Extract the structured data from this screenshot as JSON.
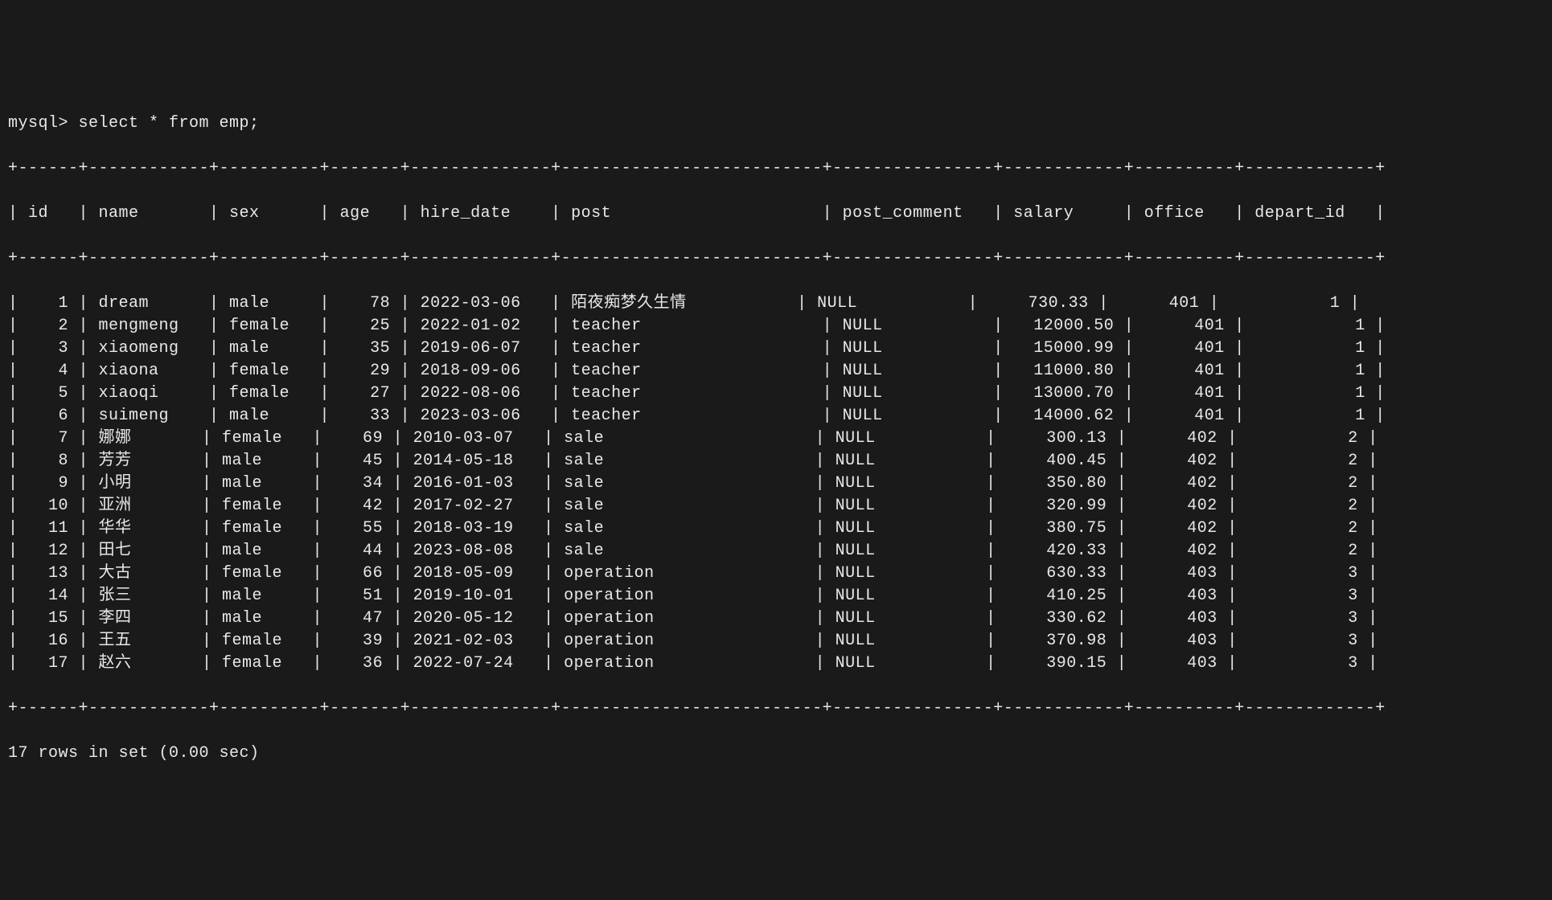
{
  "prompt": "mysql> select * from emp;",
  "chart_data": {
    "type": "table",
    "columns": [
      "id",
      "name",
      "sex",
      "age",
      "hire_date",
      "post",
      "post_comment",
      "salary",
      "office",
      "depart_id"
    ],
    "rows": [
      {
        "id": "1",
        "name": "dream",
        "sex": "male",
        "age": "78",
        "hire_date": "2022-03-06",
        "post": "陌夜痴梦久生情",
        "post_comment": "NULL",
        "salary": "730.33",
        "office": "401",
        "depart_id": "1"
      },
      {
        "id": "2",
        "name": "mengmeng",
        "sex": "female",
        "age": "25",
        "hire_date": "2022-01-02",
        "post": "teacher",
        "post_comment": "NULL",
        "salary": "12000.50",
        "office": "401",
        "depart_id": "1"
      },
      {
        "id": "3",
        "name": "xiaomeng",
        "sex": "male",
        "age": "35",
        "hire_date": "2019-06-07",
        "post": "teacher",
        "post_comment": "NULL",
        "salary": "15000.99",
        "office": "401",
        "depart_id": "1"
      },
      {
        "id": "4",
        "name": "xiaona",
        "sex": "female",
        "age": "29",
        "hire_date": "2018-09-06",
        "post": "teacher",
        "post_comment": "NULL",
        "salary": "11000.80",
        "office": "401",
        "depart_id": "1"
      },
      {
        "id": "5",
        "name": "xiaoqi",
        "sex": "female",
        "age": "27",
        "hire_date": "2022-08-06",
        "post": "teacher",
        "post_comment": "NULL",
        "salary": "13000.70",
        "office": "401",
        "depart_id": "1"
      },
      {
        "id": "6",
        "name": "suimeng",
        "sex": "male",
        "age": "33",
        "hire_date": "2023-03-06",
        "post": "teacher",
        "post_comment": "NULL",
        "salary": "14000.62",
        "office": "401",
        "depart_id": "1"
      },
      {
        "id": "7",
        "name": "娜娜",
        "sex": "female",
        "age": "69",
        "hire_date": "2010-03-07",
        "post": "sale",
        "post_comment": "NULL",
        "salary": "300.13",
        "office": "402",
        "depart_id": "2"
      },
      {
        "id": "8",
        "name": "芳芳",
        "sex": "male",
        "age": "45",
        "hire_date": "2014-05-18",
        "post": "sale",
        "post_comment": "NULL",
        "salary": "400.45",
        "office": "402",
        "depart_id": "2"
      },
      {
        "id": "9",
        "name": "小明",
        "sex": "male",
        "age": "34",
        "hire_date": "2016-01-03",
        "post": "sale",
        "post_comment": "NULL",
        "salary": "350.80",
        "office": "402",
        "depart_id": "2"
      },
      {
        "id": "10",
        "name": "亚洲",
        "sex": "female",
        "age": "42",
        "hire_date": "2017-02-27",
        "post": "sale",
        "post_comment": "NULL",
        "salary": "320.99",
        "office": "402",
        "depart_id": "2"
      },
      {
        "id": "11",
        "name": "华华",
        "sex": "female",
        "age": "55",
        "hire_date": "2018-03-19",
        "post": "sale",
        "post_comment": "NULL",
        "salary": "380.75",
        "office": "402",
        "depart_id": "2"
      },
      {
        "id": "12",
        "name": "田七",
        "sex": "male",
        "age": "44",
        "hire_date": "2023-08-08",
        "post": "sale",
        "post_comment": "NULL",
        "salary": "420.33",
        "office": "402",
        "depart_id": "2"
      },
      {
        "id": "13",
        "name": "大古",
        "sex": "female",
        "age": "66",
        "hire_date": "2018-05-09",
        "post": "operation",
        "post_comment": "NULL",
        "salary": "630.33",
        "office": "403",
        "depart_id": "3"
      },
      {
        "id": "14",
        "name": "张三",
        "sex": "male",
        "age": "51",
        "hire_date": "2019-10-01",
        "post": "operation",
        "post_comment": "NULL",
        "salary": "410.25",
        "office": "403",
        "depart_id": "3"
      },
      {
        "id": "15",
        "name": "李四",
        "sex": "male",
        "age": "47",
        "hire_date": "2020-05-12",
        "post": "operation",
        "post_comment": "NULL",
        "salary": "330.62",
        "office": "403",
        "depart_id": "3"
      },
      {
        "id": "16",
        "name": "王五",
        "sex": "female",
        "age": "39",
        "hire_date": "2021-02-03",
        "post": "operation",
        "post_comment": "NULL",
        "salary": "370.98",
        "office": "403",
        "depart_id": "3"
      },
      {
        "id": "17",
        "name": "赵六",
        "sex": "female",
        "age": "36",
        "hire_date": "2022-07-24",
        "post": "operation",
        "post_comment": "NULL",
        "salary": "390.15",
        "office": "403",
        "depart_id": "3"
      }
    ]
  },
  "column_widths": {
    "id": 4,
    "name": 10,
    "sex": 8,
    "age": 5,
    "hire_date": 12,
    "post": 24,
    "post_comment": 14,
    "salary": 10,
    "office": 8,
    "depart_id": 11
  },
  "column_align": {
    "id": "right",
    "name": "left",
    "sex": "left",
    "age": "right",
    "hire_date": "left",
    "post": "left",
    "post_comment": "left",
    "salary": "right",
    "office": "right",
    "depart_id": "right"
  },
  "footer": "17 rows in set (0.00 sec)"
}
